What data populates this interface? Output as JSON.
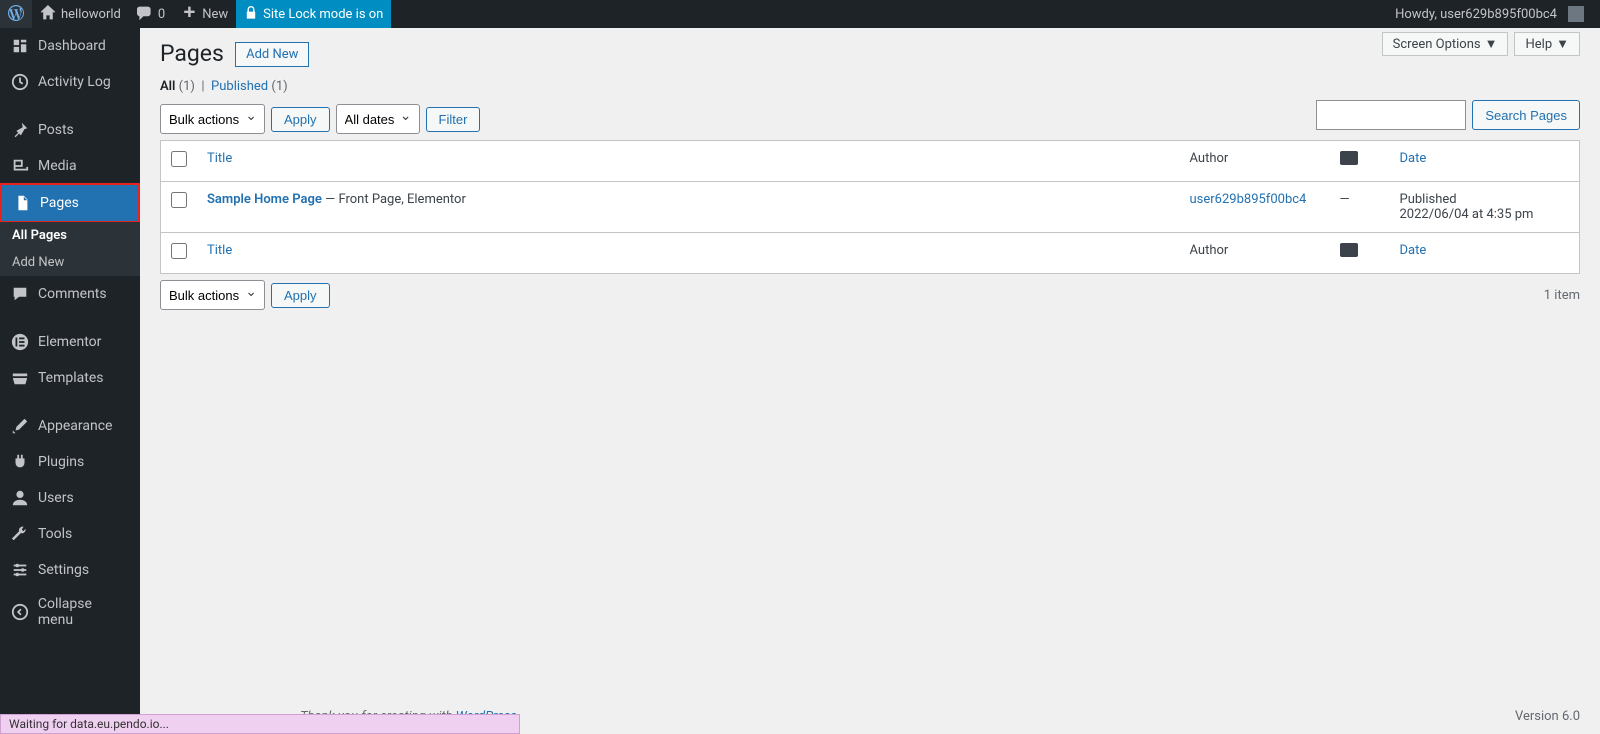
{
  "adminbar": {
    "site_name": "helloworld",
    "comments_count": "0",
    "new_label": "New",
    "sitelock_label": "Site Lock mode is on",
    "howdy": "Howdy, user629b895f00bc4"
  },
  "sidebar": {
    "items": [
      {
        "label": "Dashboard",
        "icon": "dashboard-icon"
      },
      {
        "label": "Activity Log",
        "icon": "activity-icon"
      },
      {
        "label": "Posts",
        "icon": "pin-icon"
      },
      {
        "label": "Media",
        "icon": "media-icon"
      },
      {
        "label": "Pages",
        "icon": "page-icon"
      },
      {
        "label": "Comments",
        "icon": "comment-icon"
      },
      {
        "label": "Elementor",
        "icon": "elementor-icon"
      },
      {
        "label": "Templates",
        "icon": "templates-icon"
      },
      {
        "label": "Appearance",
        "icon": "brush-icon"
      },
      {
        "label": "Plugins",
        "icon": "plug-icon"
      },
      {
        "label": "Users",
        "icon": "user-icon"
      },
      {
        "label": "Tools",
        "icon": "wrench-icon"
      },
      {
        "label": "Settings",
        "icon": "settings-icon"
      },
      {
        "label": "Collapse menu",
        "icon": "collapse-icon"
      }
    ],
    "submenu": {
      "all_pages": "All Pages",
      "add_new": "Add New"
    }
  },
  "screen": {
    "screen_options": "Screen Options",
    "help": "Help"
  },
  "page": {
    "title": "Pages",
    "add_new": "Add New"
  },
  "filters": {
    "all_label": "All",
    "all_count": "(1)",
    "published_label": "Published",
    "published_count": "(1)",
    "bulk_actions": "Bulk actions",
    "apply": "Apply",
    "all_dates": "All dates",
    "filter": "Filter",
    "items_count": "1 item",
    "search_pages": "Search Pages"
  },
  "table": {
    "headers": {
      "title": "Title",
      "author": "Author",
      "date": "Date"
    },
    "rows": [
      {
        "title": "Sample Home Page",
        "states": " — Front Page, Elementor",
        "author": "user629b895f00bc4",
        "comments": "—",
        "date_status": "Published",
        "date_value": "2022/06/04 at 4:35 pm"
      }
    ]
  },
  "footer": {
    "thankyou_prefix": "Thank you for creating with ",
    "thankyou_link": "WordPress",
    "version": "Version 6.0"
  },
  "status": "Waiting for data.eu.pendo.io..."
}
